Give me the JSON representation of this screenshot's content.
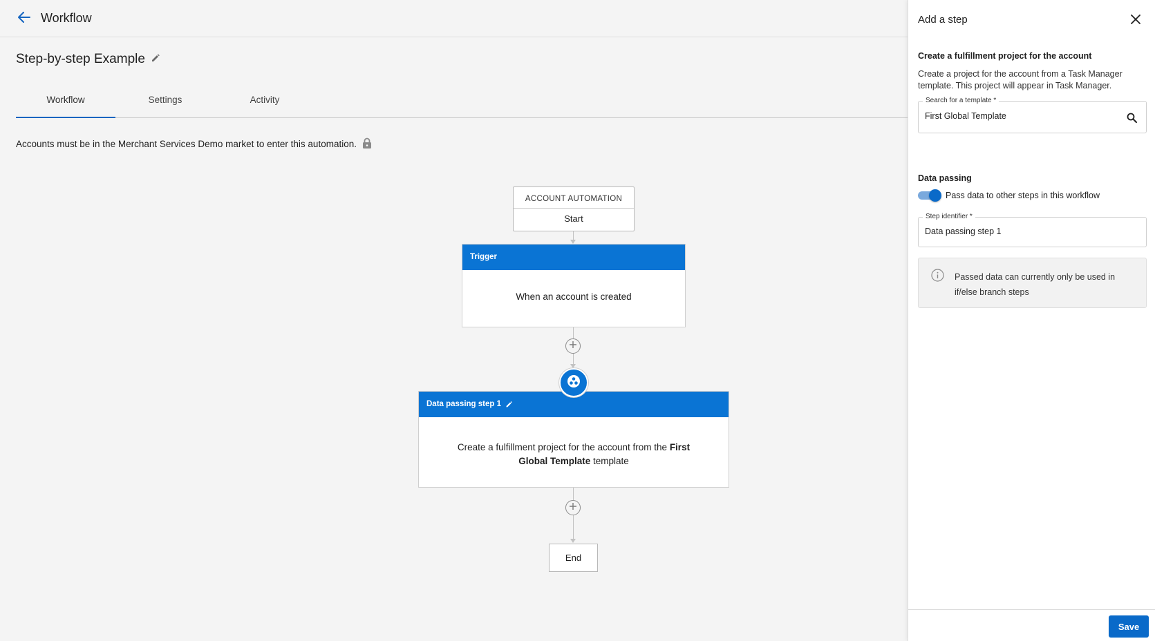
{
  "topbar": {
    "title": "Workflow"
  },
  "page": {
    "title": "Step-by-step Example"
  },
  "tabs": [
    {
      "label": "Workflow",
      "active": true
    },
    {
      "label": "Settings",
      "active": false
    },
    {
      "label": "Activity",
      "active": false
    }
  ],
  "notice": {
    "text": "Accounts must be in the Merchant Services Demo market to enter this automation."
  },
  "flow": {
    "start": {
      "top_label": "ACCOUNT AUTOMATION",
      "bottom_label": "Start"
    },
    "trigger": {
      "header": "Trigger",
      "body": "When an account is created"
    },
    "step": {
      "header": "Data passing step 1",
      "body_pre": "Create a fulfillment project for the account from the ",
      "body_bold": "First Global Template",
      "body_post": " template"
    },
    "end": {
      "label": "End"
    }
  },
  "panel": {
    "title": "Add a step",
    "section_title": "Create a fulfillment project for the account",
    "description": "Create a project for the account from a Task Manager template. This project will appear in Task Manager.",
    "template_field": {
      "label": "Search for a template *",
      "value": "First Global Template"
    },
    "data_passing": {
      "title": "Data passing",
      "toggle_label": "Pass data to other steps in this workflow",
      "toggle_on": true
    },
    "step_identifier": {
      "label": "Step identifier *",
      "value": "Data passing step 1"
    },
    "info": {
      "text": "Passed data can currently only be used in if/else branch steps"
    },
    "save_label": "Save"
  },
  "colors": {
    "accent": "#0a74d4",
    "button": "#0a6ac9"
  },
  "icons": [
    "back-arrow-icon",
    "pencil-icon",
    "lock-icon",
    "plus-icon",
    "data-passing-icon",
    "close-icon",
    "search-icon",
    "info-icon"
  ]
}
